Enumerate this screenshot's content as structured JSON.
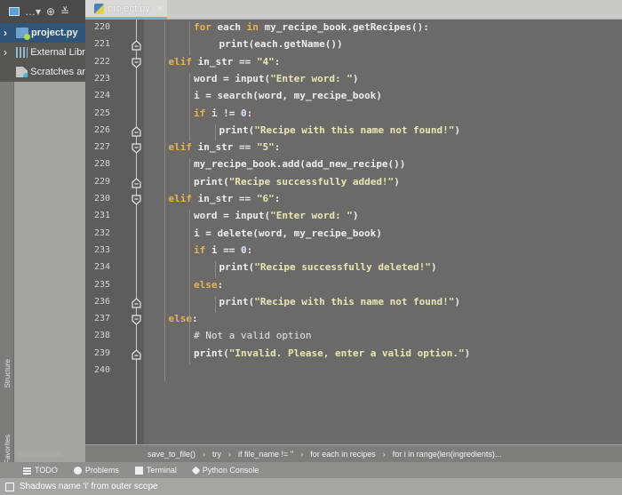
{
  "tabbar": {
    "tabs": [
      {
        "label": "project.py",
        "active": true
      }
    ]
  },
  "project_panel": {
    "toolbar_icons": [
      "project-view-icon",
      "dropdown-icon",
      "locate-icon",
      "collapse-all-icon"
    ],
    "tree": [
      {
        "label": "project.py",
        "icon": "python-folder-icon",
        "expandable": true,
        "selected": true
      },
      {
        "label": "External Libr",
        "icon": "library-icon",
        "expandable": true,
        "selected": false
      },
      {
        "label": "Scratches ar",
        "icon": "scratches-icon",
        "expandable": false,
        "selected": false
      }
    ]
  },
  "tool_strip": {
    "structure": "Structure",
    "favorites": "Favorites"
  },
  "editor": {
    "lines": [
      {
        "n": "220",
        "indent": 2,
        "html": "<span class='kw'>for</span> each <span class='kw'>in</span> my_recipe_book.getRecipes():"
      },
      {
        "n": "221",
        "indent": 3,
        "html": "print(each.getName())",
        "fold": "end"
      },
      {
        "n": "222",
        "indent": 1,
        "html": "<span class='kw'>elif</span> in_str == <span class='str'>\"4\"</span>:",
        "fold": "start"
      },
      {
        "n": "223",
        "indent": 2,
        "html": "word = input(<span class='str'>\"Enter word: \"</span>)"
      },
      {
        "n": "224",
        "indent": 2,
        "html": "i = search(word, my_recipe_book)"
      },
      {
        "n": "225",
        "indent": 2,
        "html": "<span class='kw'>if</span> i != <span class='num'>0</span>:"
      },
      {
        "n": "226",
        "indent": 3,
        "html": "print(<span class='str'>\"Recipe with this name not found!\"</span>)",
        "fold": "end"
      },
      {
        "n": "227",
        "indent": 1,
        "html": "<span class='kw'>elif</span> in_str == <span class='str'>\"5\"</span>:",
        "fold": "start"
      },
      {
        "n": "228",
        "indent": 2,
        "html": "my_recipe_book.add(add_new_recipe())"
      },
      {
        "n": "229",
        "indent": 2,
        "html": "print(<span class='str'>\"Recipe successfully added!\"</span>)",
        "fold": "end"
      },
      {
        "n": "230",
        "indent": 1,
        "html": "<span class='kw'>elif</span> in_str == <span class='str'>\"6\"</span>:",
        "fold": "start"
      },
      {
        "n": "231",
        "indent": 2,
        "html": "word = input(<span class='str'>\"Enter word: \"</span>)"
      },
      {
        "n": "232",
        "indent": 2,
        "html": "i = delete(word, my_recipe_book)"
      },
      {
        "n": "233",
        "indent": 2,
        "html": "<span class='kw'>if</span> i == <span class='num'>0</span>:"
      },
      {
        "n": "234",
        "indent": 3,
        "html": "print(<span class='str'>\"Recipe successfully deleted!\"</span>)"
      },
      {
        "n": "235",
        "indent": 2,
        "html": "<span class='kw'>else</span>:"
      },
      {
        "n": "236",
        "indent": 3,
        "html": "print(<span class='str'>\"Recipe with this name not found!\"</span>)",
        "fold": "end"
      },
      {
        "n": "237",
        "indent": 1,
        "html": "<span class='kw'>else</span>:",
        "fold": "start"
      },
      {
        "n": "238",
        "indent": 2,
        "html": "<span class='cm'># Not a valid option</span>"
      },
      {
        "n": "239",
        "indent": 2,
        "html": "print(<span class='str'>\"Invalid. Please, enter a valid option.\"</span>)",
        "fold": "end"
      },
      {
        "n": "240",
        "indent": 1,
        "html": ""
      }
    ]
  },
  "breadcrumbs": [
    "save_to_file()",
    "try",
    "if file_name != ''",
    "for each in recipes",
    "for i in range(len(ingredients)..."
  ],
  "bottom_tabs": [
    {
      "label": "TODO",
      "icon": "todo-icon"
    },
    {
      "label": "Problems",
      "icon": "problems-icon"
    },
    {
      "label": "Terminal",
      "icon": "terminal-icon"
    },
    {
      "label": "Python Console",
      "icon": "python-console-icon"
    }
  ],
  "status": {
    "message": "Shadows name 'i' from outer scope"
  },
  "colors": {
    "keyword": "#e8b250",
    "string": "#e9e7b4",
    "tab_underline": "#5fb8e2",
    "selection": "#2f557a"
  }
}
